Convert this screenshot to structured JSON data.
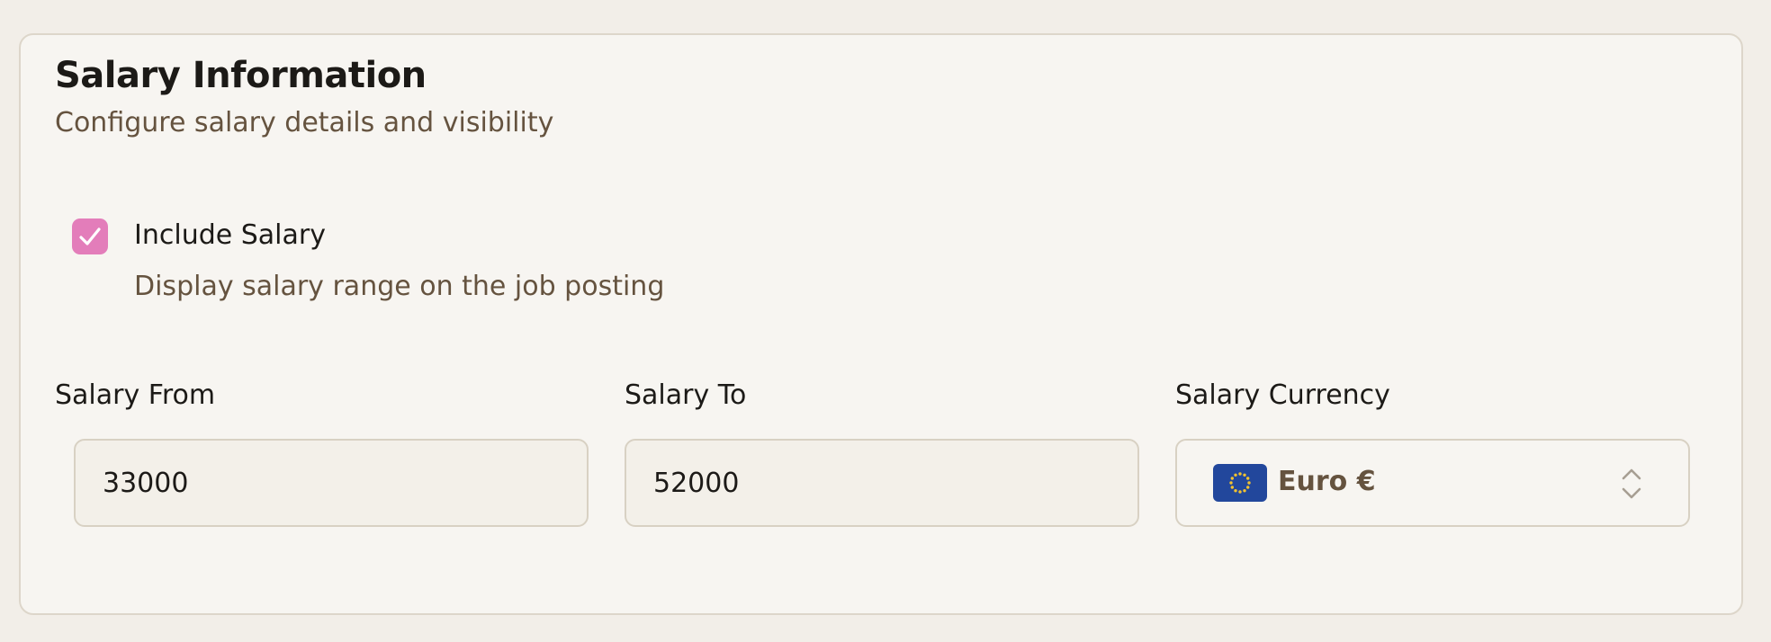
{
  "section": {
    "title": "Salary Information",
    "subtitle": "Configure salary details and visibility"
  },
  "include_salary": {
    "checked": true,
    "label": "Include Salary",
    "description": "Display salary range on the job posting"
  },
  "fields": {
    "salary_from": {
      "label": "Salary From",
      "value": "33000"
    },
    "salary_to": {
      "label": "Salary To",
      "value": "52000"
    },
    "salary_currency": {
      "label": "Salary Currency",
      "value": "Euro €",
      "icon": "eu-flag-icon"
    }
  },
  "colors": {
    "background": "#f2eee8",
    "card": "#f7f5f1",
    "checkbox_accent": "#e37dba",
    "muted_text": "#65533f",
    "eu_flag_blue": "#22479c",
    "eu_flag_stars": "#f2c230"
  }
}
